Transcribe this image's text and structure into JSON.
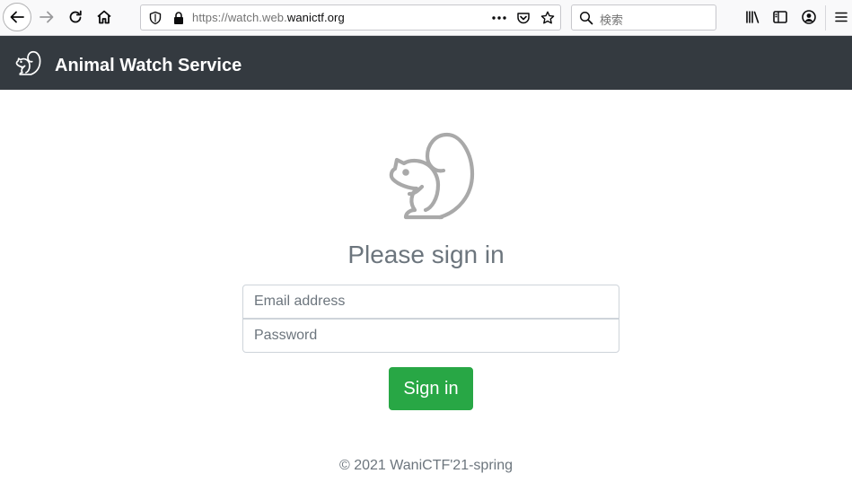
{
  "browser": {
    "url_prefix": "https://watch.web.",
    "url_host": "wanictf.org",
    "search_placeholder": "検索",
    "icons": {
      "back": "back-arrow-icon",
      "forward": "forward-arrow-icon",
      "reload": "reload-icon",
      "home": "home-icon",
      "tracking": "tracking-protection-icon",
      "lock": "lock-icon",
      "more": "more-dots-icon",
      "pocket": "pocket-icon",
      "bookmark": "star-icon",
      "search": "search-icon",
      "library": "library-icon",
      "sidebar": "sidebar-icon",
      "account": "account-icon",
      "menu": "hamburger-menu-icon"
    }
  },
  "navbar": {
    "brand": "Animal Watch Service",
    "background": "#343a40",
    "logo_icon": "squirrel-icon"
  },
  "form": {
    "heading": "Please sign in",
    "email_placeholder": "Email address",
    "password_placeholder": "Password",
    "submit_label": "Sign in",
    "submit_color": "#28a745",
    "hero_icon": "squirrel-icon"
  },
  "footer": {
    "text": "© 2021 WaniCTF'21-spring"
  }
}
